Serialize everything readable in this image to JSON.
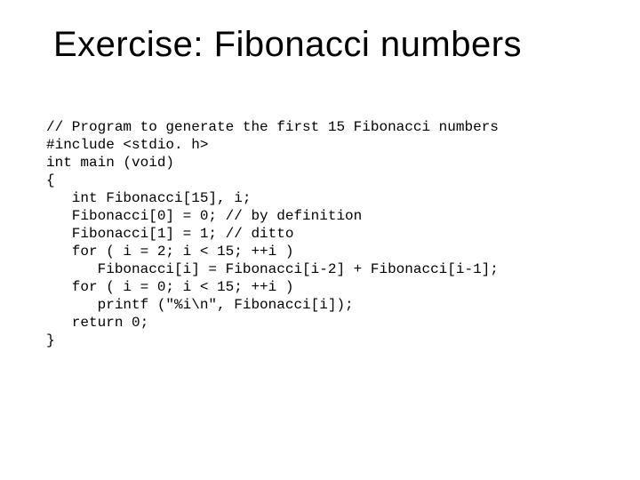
{
  "title": "Exercise: Fibonacci numbers",
  "code": {
    "l1": "// Program to generate the first 15 Fibonacci numbers",
    "l2": "#include <stdio. h>",
    "l3": "int main (void)",
    "l4": "{",
    "l5": "   int Fibonacci[15], i;",
    "l6": "   Fibonacci[0] = 0; // by definition",
    "l7": "   Fibonacci[1] = 1; // ditto",
    "l8": "   for ( i = 2; i < 15; ++i )",
    "l9": "      Fibonacci[i] = Fibonacci[i-2] + Fibonacci[i-1];",
    "l10": "   for ( i = 0; i < 15; ++i )",
    "l11": "      printf (\"%i\\n\", Fibonacci[i]);",
    "l12": "   return 0;",
    "l13": "}"
  }
}
